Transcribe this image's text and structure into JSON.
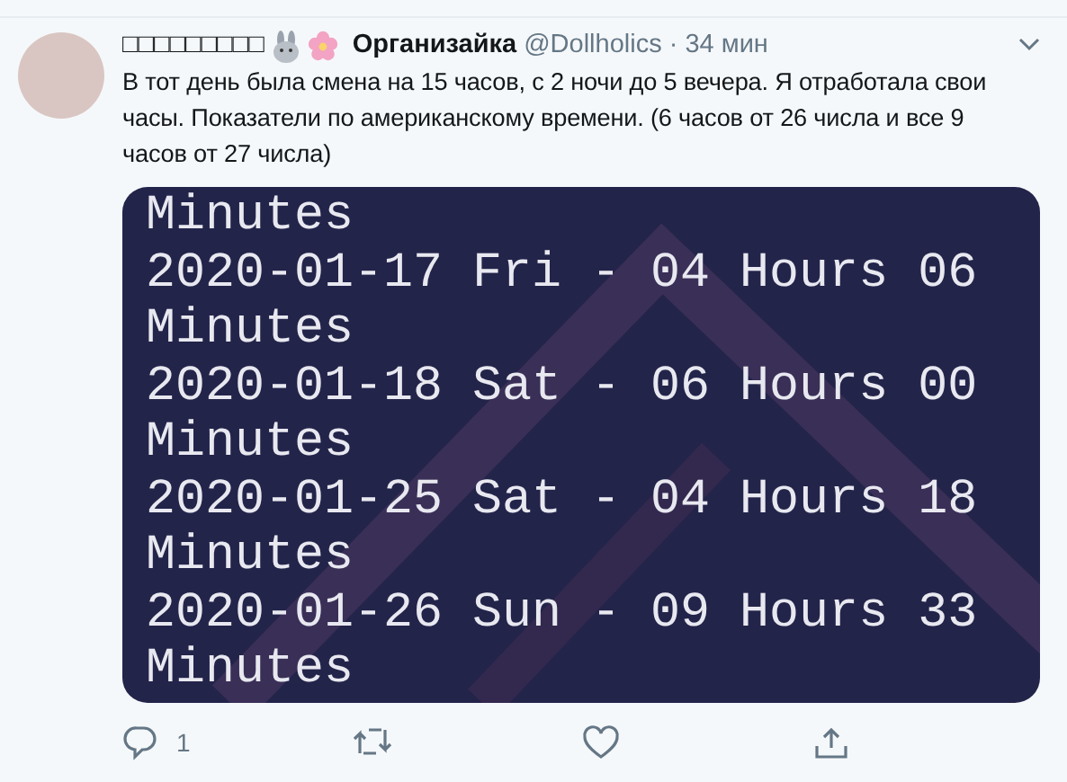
{
  "tweet": {
    "author_name": "□□□□□□□□□",
    "display_name": "Организайка",
    "handle": "@Dollholics",
    "separator": "·",
    "time": "34 мин",
    "text": "В тот день была смена на 15 часов, с 2 ночи до 5 вечера. Я отработала свои часы. Показатели по американскому времени. (6 часов от 26 числа и все 9 часов от 27 числа)",
    "image_lines": [
      "Minutes",
      "2020-01-17 Fri - 04 Hours 06",
      "Minutes",
      "2020-01-18 Sat - 06 Hours 00",
      "Minutes",
      "2020-01-25 Sat - 04 Hours 18",
      "Minutes",
      "2020-01-26 Sun - 09 Hours 33",
      "Minutes"
    ],
    "actions": [
      {
        "kind": "reply",
        "count": "1"
      },
      {
        "kind": "retweet"
      },
      {
        "kind": "like"
      },
      {
        "kind": "share"
      }
    ]
  }
}
